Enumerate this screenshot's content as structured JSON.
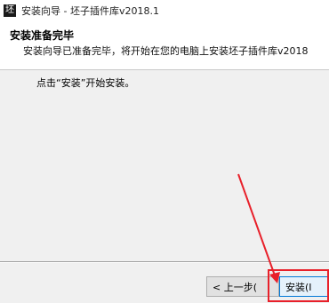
{
  "window": {
    "icon_glyph": "坯",
    "title": "安装向导 - 坯子插件库v2018.1"
  },
  "header": {
    "title": "安装准备完毕",
    "subtitle": "安装向导已准备完毕，将开始在您的电脑上安装坯子插件库v2018"
  },
  "content": {
    "instruction": "点击“安装”开始安装。"
  },
  "buttons": {
    "back_label": "< 上一步(",
    "install_label": "安装(I"
  },
  "annotation": {
    "color": "#e8202a"
  }
}
